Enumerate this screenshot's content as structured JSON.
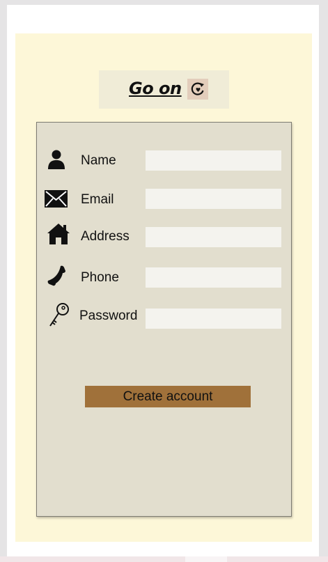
{
  "brand": {
    "title": "Go on",
    "icon": "refresh-heart-icon"
  },
  "form": {
    "fields": [
      {
        "label": "Name",
        "icon": "person-icon",
        "value": "",
        "placeholder": ""
      },
      {
        "label": "Email",
        "icon": "envelope-icon",
        "value": "",
        "placeholder": ""
      },
      {
        "label": "Address",
        "icon": "house-icon",
        "value": "",
        "placeholder": ""
      },
      {
        "label": "Phone",
        "icon": "phone-icon",
        "value": "",
        "placeholder": ""
      },
      {
        "label": "Password",
        "icon": "key-icon",
        "value": "",
        "placeholder": ""
      }
    ],
    "submit_label": "Create account"
  },
  "colors": {
    "page_bg": "#fdf7d8",
    "card_bg": "#e2dece",
    "field_bg": "#f4f3ee",
    "button_bg": "#a0713a",
    "brand_bg": "#f0ecd7",
    "brand_icon_bg": "#e3cdbb"
  }
}
